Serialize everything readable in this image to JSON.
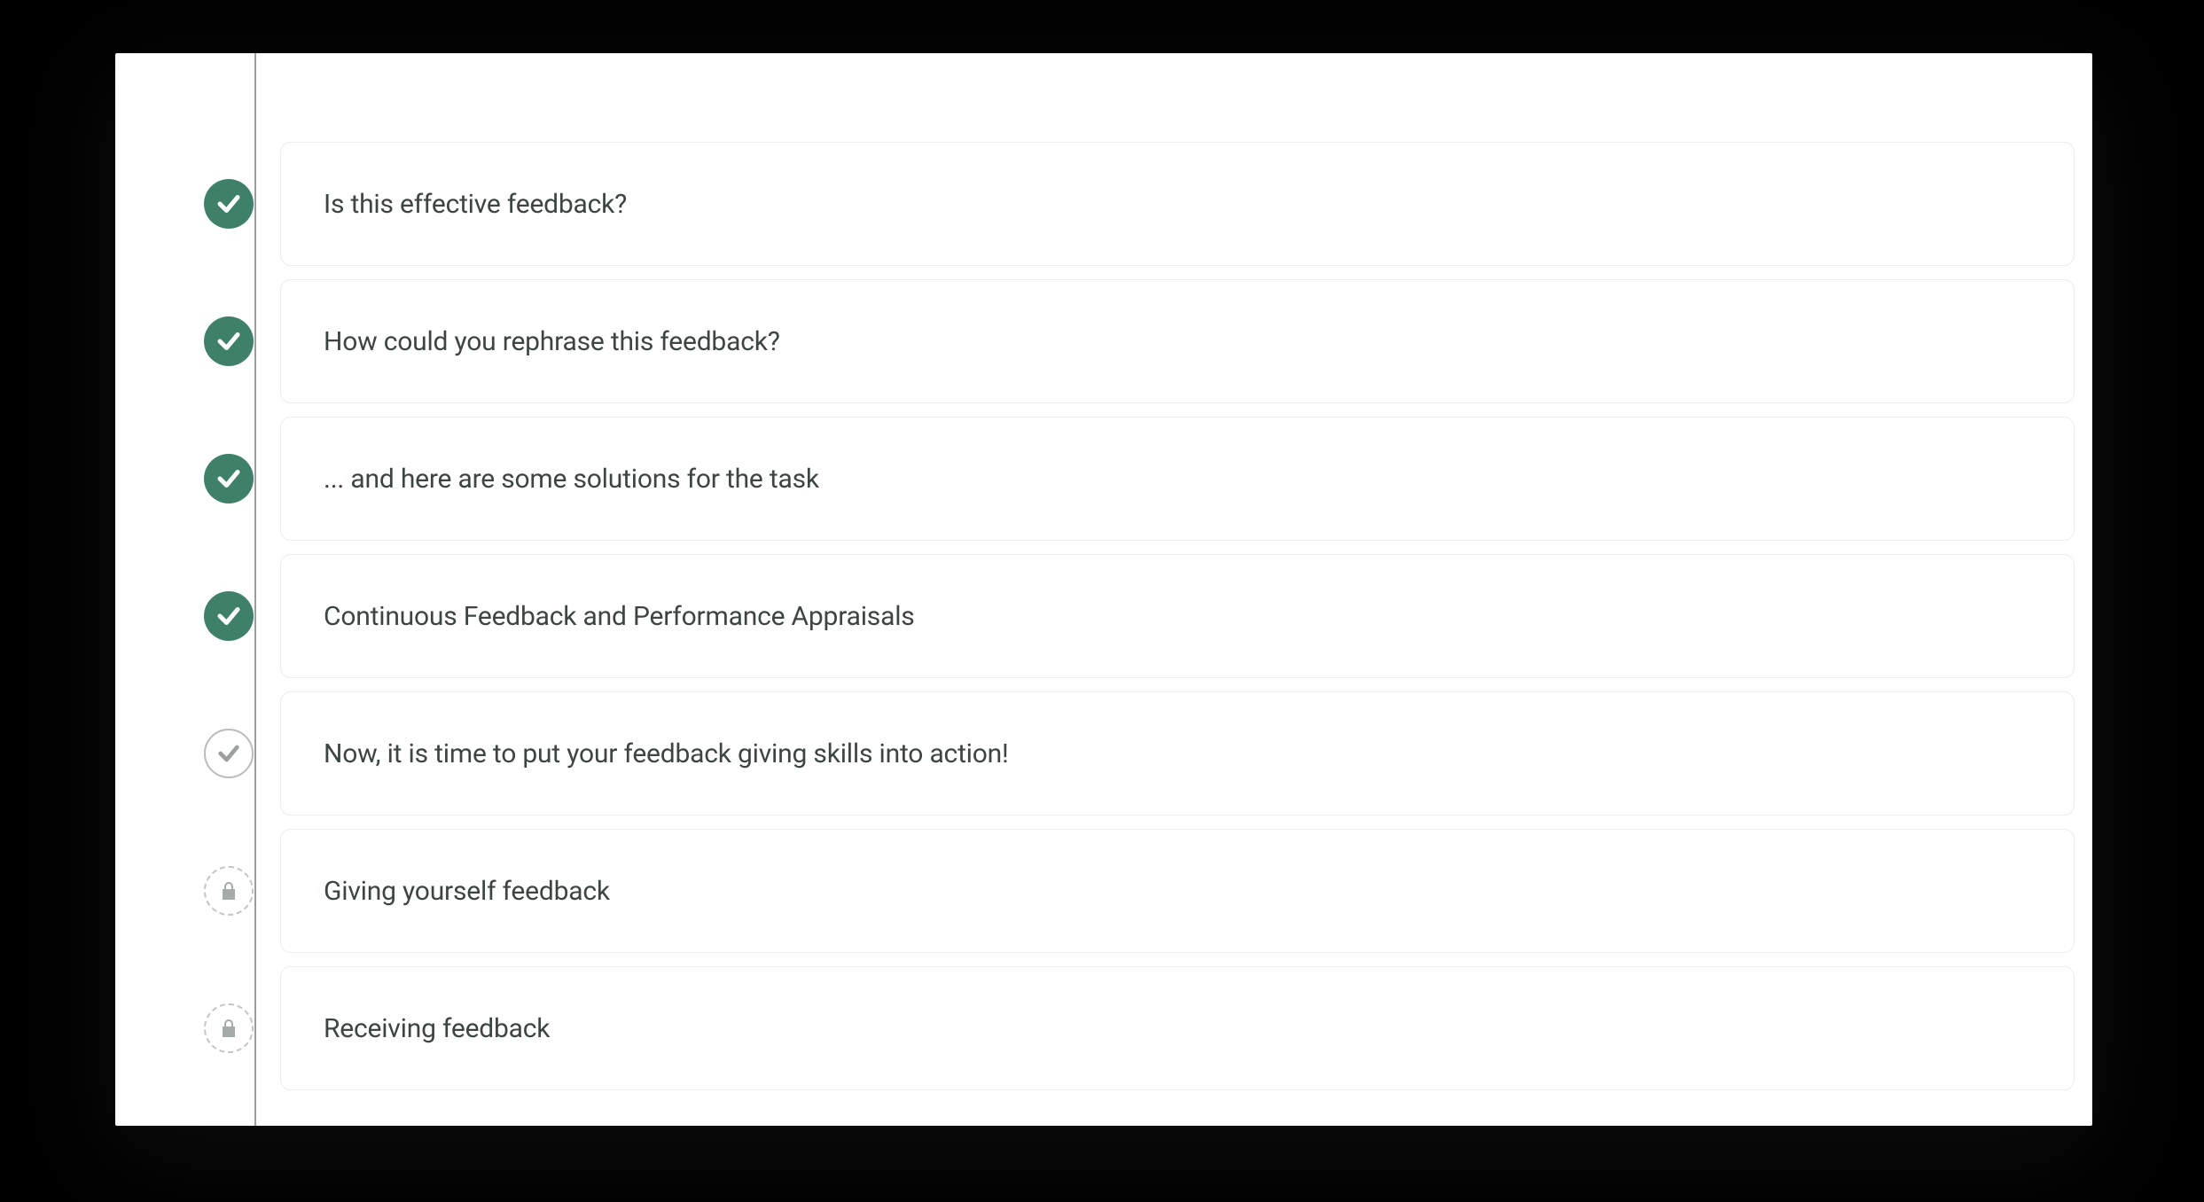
{
  "colors": {
    "complete": "#3e8168",
    "neutral": "#9aa19e",
    "text": "#3d4542",
    "border": "#ebedec"
  },
  "items": [
    {
      "status": "complete",
      "label": "Is this effective feedback?"
    },
    {
      "status": "complete",
      "label": "How could you rephrase this feedback?"
    },
    {
      "status": "complete",
      "label": "... and here are some solutions for the task"
    },
    {
      "status": "complete",
      "label": "Continuous Feedback and Performance Appraisals"
    },
    {
      "status": "current",
      "label": "Now, it is time to put your feedback giving skills into action!"
    },
    {
      "status": "locked",
      "label": "Giving yourself feedback"
    },
    {
      "status": "locked",
      "label": "Receiving feedback"
    }
  ]
}
